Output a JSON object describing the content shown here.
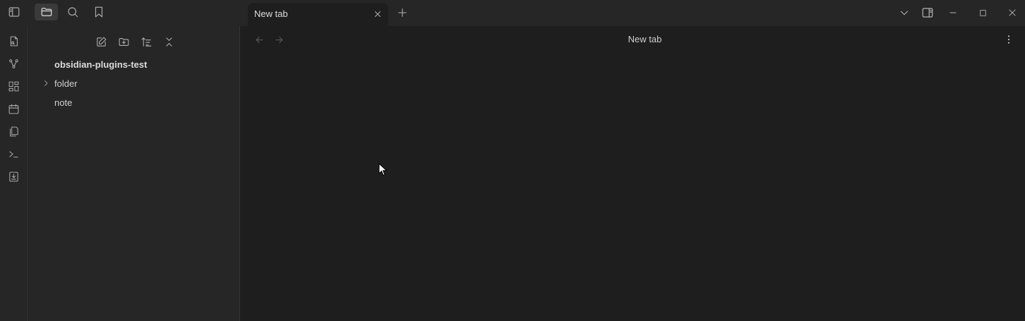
{
  "titlebar": {
    "icons": [
      "sidebar-toggle-icon",
      "folder-icon",
      "search-icon",
      "bookmark-icon"
    ],
    "window_controls": [
      "chevron-down-icon",
      "right-sidebar-icon",
      "minimize-icon",
      "maximize-icon",
      "close-icon"
    ]
  },
  "tabs": [
    {
      "title": "New tab",
      "active": true
    }
  ],
  "ribbon": {
    "icons": [
      "file-switcher-icon",
      "graph-view-icon",
      "canvas-icon",
      "calendar-icon",
      "templates-icon",
      "terminal-icon",
      "import-icon"
    ]
  },
  "explorer": {
    "nav_icons": [
      "new-note-icon",
      "new-folder-icon",
      "sort-icon",
      "collapse-all-icon"
    ],
    "vault_name": "obsidian-plugins-test",
    "items": [
      {
        "label": "folder",
        "type": "folder",
        "collapsed": true
      },
      {
        "label": "note",
        "type": "file"
      }
    ]
  },
  "main": {
    "title": "New tab"
  },
  "colors": {
    "background": "#1e1e1e",
    "panel": "#262626",
    "text": "#dadada"
  }
}
